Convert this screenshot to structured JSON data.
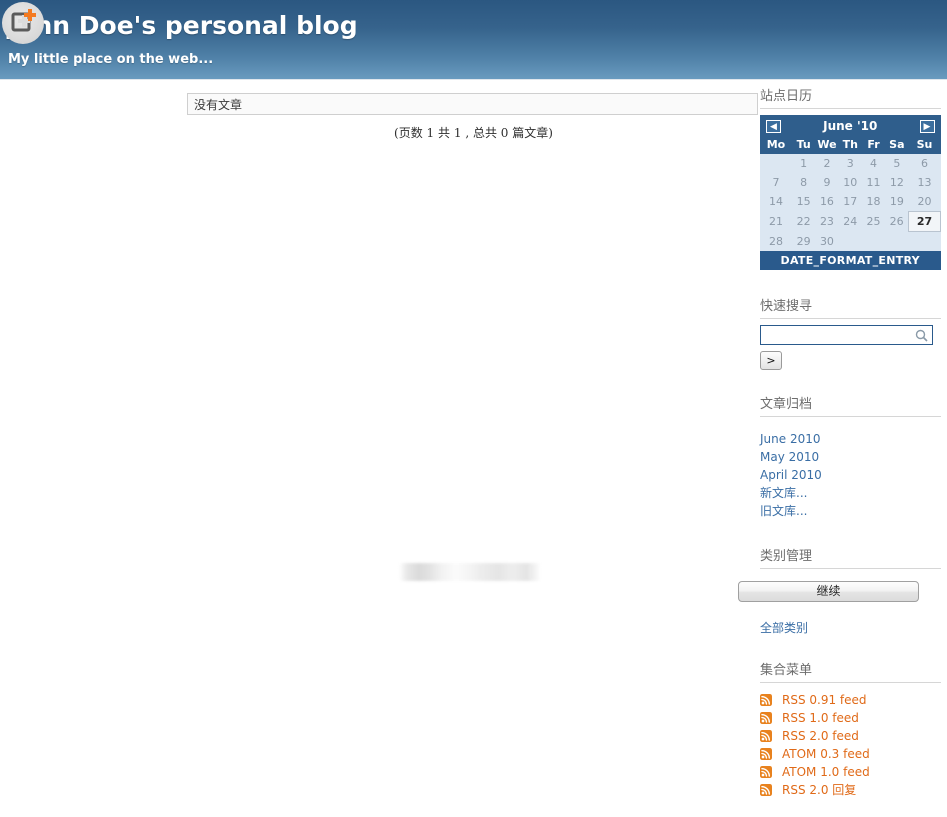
{
  "header": {
    "title": "John Doe's personal blog",
    "subtitle": "My little place on the web...",
    "badge_icon": "new-page-plus-icon",
    "gradient_top": "#2b5781",
    "gradient_bottom": "#6a9cc0"
  },
  "main": {
    "no_entries_text": "没有文章",
    "pagination": {
      "prefix": "(页数",
      "current_page": "1",
      "middle": "共",
      "total_pages": "1",
      "comma": ", 总共",
      "total_entries": "0",
      "suffix": "篇文章)"
    }
  },
  "sidebar": {
    "calendar": {
      "heading": "站点日历",
      "prev_label": "◀",
      "next_label": "▶",
      "month_label": "June '10",
      "weekdays": [
        "Mo",
        "Tu",
        "We",
        "Th",
        "Fr",
        "Sa",
        "Su"
      ],
      "weeks": [
        [
          "",
          "1",
          "2",
          "3",
          "4",
          "5",
          "6"
        ],
        [
          "7",
          "8",
          "9",
          "10",
          "11",
          "12",
          "13"
        ],
        [
          "14",
          "15",
          "16",
          "17",
          "18",
          "19",
          "20"
        ],
        [
          "21",
          "22",
          "23",
          "24",
          "25",
          "26",
          "27"
        ],
        [
          "28",
          "29",
          "30",
          "",
          "",
          "",
          ""
        ]
      ],
      "today": "27",
      "footer_label": "DATE_FORMAT_ENTRY",
      "header_bg": "#2f5e8c",
      "cell_bg": "#dce7f2",
      "footer_bg": "#2a5a8c"
    },
    "search": {
      "heading": "快速搜寻",
      "value": "",
      "placeholder": "",
      "icon": "magnifier-icon",
      "submit_label": ">"
    },
    "archives": {
      "heading": "文章归档",
      "items": [
        {
          "label": "June 2010"
        },
        {
          "label": "May 2010"
        },
        {
          "label": "April 2010"
        },
        {
          "label": "新文库..."
        },
        {
          "label": "旧文库..."
        }
      ],
      "link_color": "#3a6ea5"
    },
    "categories": {
      "heading": "类别管理",
      "continue_label": "继续",
      "all_label": "全部类别"
    },
    "syndication": {
      "heading": "集合菜单",
      "items": [
        {
          "label": "RSS 0.91 feed",
          "icon": "rss-icon"
        },
        {
          "label": "RSS 1.0 feed",
          "icon": "rss-icon"
        },
        {
          "label": "RSS 2.0 feed",
          "icon": "rss-icon"
        },
        {
          "label": "ATOM 0.3 feed",
          "icon": "rss-icon"
        },
        {
          "label": "ATOM 1.0 feed",
          "icon": "rss-icon"
        },
        {
          "label": "RSS 2.0 回复",
          "icon": "rss-icon"
        }
      ],
      "link_color": "#e06a18"
    }
  }
}
